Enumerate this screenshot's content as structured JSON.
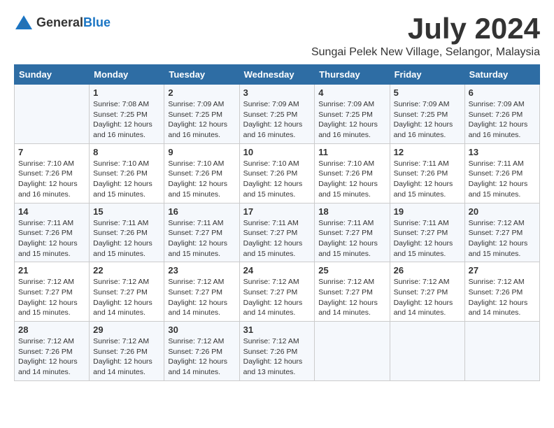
{
  "header": {
    "logo_general": "General",
    "logo_blue": "Blue",
    "month_title": "July 2024",
    "location": "Sungai Pelek New Village, Selangor, Malaysia"
  },
  "weekdays": [
    "Sunday",
    "Monday",
    "Tuesday",
    "Wednesday",
    "Thursday",
    "Friday",
    "Saturday"
  ],
  "weeks": [
    [
      {
        "day": "",
        "sunrise": "",
        "sunset": "",
        "daylight": ""
      },
      {
        "day": "1",
        "sunrise": "7:08 AM",
        "sunset": "7:25 PM",
        "daylight": "12 hours and 16 minutes."
      },
      {
        "day": "2",
        "sunrise": "7:09 AM",
        "sunset": "7:25 PM",
        "daylight": "12 hours and 16 minutes."
      },
      {
        "day": "3",
        "sunrise": "7:09 AM",
        "sunset": "7:25 PM",
        "daylight": "12 hours and 16 minutes."
      },
      {
        "day": "4",
        "sunrise": "7:09 AM",
        "sunset": "7:25 PM",
        "daylight": "12 hours and 16 minutes."
      },
      {
        "day": "5",
        "sunrise": "7:09 AM",
        "sunset": "7:25 PM",
        "daylight": "12 hours and 16 minutes."
      },
      {
        "day": "6",
        "sunrise": "7:09 AM",
        "sunset": "7:26 PM",
        "daylight": "12 hours and 16 minutes."
      }
    ],
    [
      {
        "day": "7",
        "sunrise": "7:10 AM",
        "sunset": "7:26 PM",
        "daylight": "12 hours and 16 minutes."
      },
      {
        "day": "8",
        "sunrise": "7:10 AM",
        "sunset": "7:26 PM",
        "daylight": "12 hours and 15 minutes."
      },
      {
        "day": "9",
        "sunrise": "7:10 AM",
        "sunset": "7:26 PM",
        "daylight": "12 hours and 15 minutes."
      },
      {
        "day": "10",
        "sunrise": "7:10 AM",
        "sunset": "7:26 PM",
        "daylight": "12 hours and 15 minutes."
      },
      {
        "day": "11",
        "sunrise": "7:10 AM",
        "sunset": "7:26 PM",
        "daylight": "12 hours and 15 minutes."
      },
      {
        "day": "12",
        "sunrise": "7:11 AM",
        "sunset": "7:26 PM",
        "daylight": "12 hours and 15 minutes."
      },
      {
        "day": "13",
        "sunrise": "7:11 AM",
        "sunset": "7:26 PM",
        "daylight": "12 hours and 15 minutes."
      }
    ],
    [
      {
        "day": "14",
        "sunrise": "7:11 AM",
        "sunset": "7:26 PM",
        "daylight": "12 hours and 15 minutes."
      },
      {
        "day": "15",
        "sunrise": "7:11 AM",
        "sunset": "7:26 PM",
        "daylight": "12 hours and 15 minutes."
      },
      {
        "day": "16",
        "sunrise": "7:11 AM",
        "sunset": "7:27 PM",
        "daylight": "12 hours and 15 minutes."
      },
      {
        "day": "17",
        "sunrise": "7:11 AM",
        "sunset": "7:27 PM",
        "daylight": "12 hours and 15 minutes."
      },
      {
        "day": "18",
        "sunrise": "7:11 AM",
        "sunset": "7:27 PM",
        "daylight": "12 hours and 15 minutes."
      },
      {
        "day": "19",
        "sunrise": "7:11 AM",
        "sunset": "7:27 PM",
        "daylight": "12 hours and 15 minutes."
      },
      {
        "day": "20",
        "sunrise": "7:12 AM",
        "sunset": "7:27 PM",
        "daylight": "12 hours and 15 minutes."
      }
    ],
    [
      {
        "day": "21",
        "sunrise": "7:12 AM",
        "sunset": "7:27 PM",
        "daylight": "12 hours and 15 minutes."
      },
      {
        "day": "22",
        "sunrise": "7:12 AM",
        "sunset": "7:27 PM",
        "daylight": "12 hours and 14 minutes."
      },
      {
        "day": "23",
        "sunrise": "7:12 AM",
        "sunset": "7:27 PM",
        "daylight": "12 hours and 14 minutes."
      },
      {
        "day": "24",
        "sunrise": "7:12 AM",
        "sunset": "7:27 PM",
        "daylight": "12 hours and 14 minutes."
      },
      {
        "day": "25",
        "sunrise": "7:12 AM",
        "sunset": "7:27 PM",
        "daylight": "12 hours and 14 minutes."
      },
      {
        "day": "26",
        "sunrise": "7:12 AM",
        "sunset": "7:27 PM",
        "daylight": "12 hours and 14 minutes."
      },
      {
        "day": "27",
        "sunrise": "7:12 AM",
        "sunset": "7:26 PM",
        "daylight": "12 hours and 14 minutes."
      }
    ],
    [
      {
        "day": "28",
        "sunrise": "7:12 AM",
        "sunset": "7:26 PM",
        "daylight": "12 hours and 14 minutes."
      },
      {
        "day": "29",
        "sunrise": "7:12 AM",
        "sunset": "7:26 PM",
        "daylight": "12 hours and 14 minutes."
      },
      {
        "day": "30",
        "sunrise": "7:12 AM",
        "sunset": "7:26 PM",
        "daylight": "12 hours and 14 minutes."
      },
      {
        "day": "31",
        "sunrise": "7:12 AM",
        "sunset": "7:26 PM",
        "daylight": "12 hours and 13 minutes."
      },
      {
        "day": "",
        "sunrise": "",
        "sunset": "",
        "daylight": ""
      },
      {
        "day": "",
        "sunrise": "",
        "sunset": "",
        "daylight": ""
      },
      {
        "day": "",
        "sunrise": "",
        "sunset": "",
        "daylight": ""
      }
    ]
  ]
}
